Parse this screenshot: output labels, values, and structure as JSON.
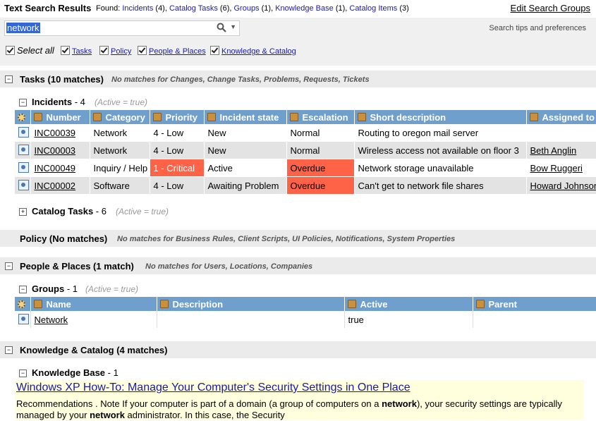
{
  "header": {
    "title": "Text Search Results",
    "found_label": "Found:",
    "found": [
      {
        "name": "Incidents",
        "count": "(4),"
      },
      {
        "name": "Catalog Tasks",
        "count": "(6),"
      },
      {
        "name": "Groups",
        "count": "(1),"
      },
      {
        "name": "Knowledge Base",
        "count": "(1),"
      },
      {
        "name": "Catalog Items",
        "count": "(3)"
      }
    ],
    "edit_groups": "Edit Search Groups"
  },
  "search": {
    "value": "network",
    "tips": "Search tips and preferences"
  },
  "filters": {
    "select_all": "Select all",
    "items": [
      "Tasks",
      "Policy",
      "People & Places",
      "Knowledge & Catalog"
    ]
  },
  "sections": {
    "tasks": {
      "label": "Tasks (10 matches)",
      "note": "No matches for Changes, Change Tasks, Problems, Requests, Tickets"
    },
    "policy": {
      "label": "Policy (No matches)",
      "note": "No matches for Business Rules, Client Scripts, UI Policies, Notifications, System Properties"
    },
    "people": {
      "label": "People & Places (1 match)",
      "note": "No matches for Users, Locations, Companies"
    },
    "knowledge": {
      "label": "Knowledge & Catalog (4 matches)"
    }
  },
  "incidents": {
    "label": "Incidents",
    "count": " - 4",
    "active": "(Active = true)",
    "columns": [
      "Number",
      "Category",
      "Priority",
      "Incident state",
      "Escalation",
      "Short description",
      "Assigned to"
    ],
    "rows": [
      {
        "number": "INC00039",
        "category": "Network",
        "priority": "4 - Low",
        "state": "New",
        "escalation": "Normal",
        "description": "Routing to oregon mail server",
        "assigned": ""
      },
      {
        "number": "INC00003",
        "category": "Network",
        "priority": "4 - Low",
        "state": "New",
        "escalation": "Normal",
        "description": "Wireless access not available on floor 3",
        "assigned": "Beth Anglin"
      },
      {
        "number": "INC00049",
        "category": "Inquiry / Help",
        "priority": "1 - Critical",
        "state": "Active",
        "escalation": "Overdue",
        "description": "Network storage unavailable",
        "assigned": "Bow Ruggeri"
      },
      {
        "number": "INC00002",
        "category": "Software",
        "priority": "4 - Low",
        "state": "Awaiting Problem",
        "escalation": "Overdue",
        "description": "Can't get to network file shares",
        "assigned": "Howard Johnson"
      }
    ]
  },
  "catalog_tasks": {
    "label": "Catalog Tasks",
    "count": " - 6",
    "active": "(Active = true)"
  },
  "groups": {
    "label": "Groups",
    "count": " - 1",
    "active": "(Active = true)",
    "columns": [
      "Name",
      "Description",
      "Active",
      "Parent"
    ],
    "rows": [
      {
        "name": "Network",
        "description": "",
        "active": "true",
        "parent": ""
      }
    ]
  },
  "knowledge_base": {
    "label": "Knowledge Base",
    "count": " - 1",
    "article_title": "Windows XP How-To: Manage Your Computer's Security Settings in One Place",
    "snippet_1": "Recommendations . Note If your computer is part of a domain (a group of computers on a ",
    "snippet_bold_1": "network",
    "snippet_2": "), your security settings are typically managed by your ",
    "snippet_bold_2": "network",
    "snippet_3": " administrator. In this case, the Security"
  },
  "colors": {
    "header_blue": "#6e9fcd",
    "critical": "#ff6347",
    "section_bg": "#ebebeb",
    "kb_bg": "#fffedd"
  }
}
